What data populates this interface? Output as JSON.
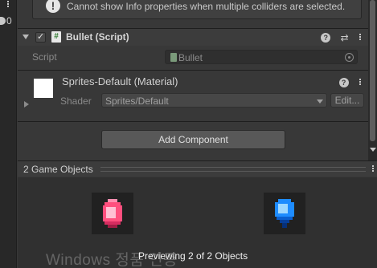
{
  "info": {
    "icon": "info-icon",
    "text": "Cannot show Info properties when multiple colliders are selected."
  },
  "left_panel": {
    "count": "0"
  },
  "component": {
    "title": "Bullet (Script)",
    "script_label": "Script",
    "script_value": "Bullet",
    "help_glyph": "?",
    "preset_glyph": "⇄"
  },
  "material": {
    "title": "Sprites-Default (Material)",
    "shader_label": "Shader",
    "shader_value": "Sprites/Default",
    "edit_label": "Edit..."
  },
  "add_component_label": "Add Component",
  "preview": {
    "title": "2 Game Objects",
    "caption": "Previewing 2 of 2 Objects",
    "sprites": [
      {
        "name": "pink-bullet",
        "color": "#ff4f7e"
      },
      {
        "name": "blue-bullet",
        "color": "#1e8cff"
      }
    ]
  },
  "watermark": "Windows 정품 인증",
  "colors": {
    "panel_bg": "#383838",
    "header_bg": "#3c3c3c",
    "preview_bg": "#303030",
    "button_bg": "#585858"
  }
}
